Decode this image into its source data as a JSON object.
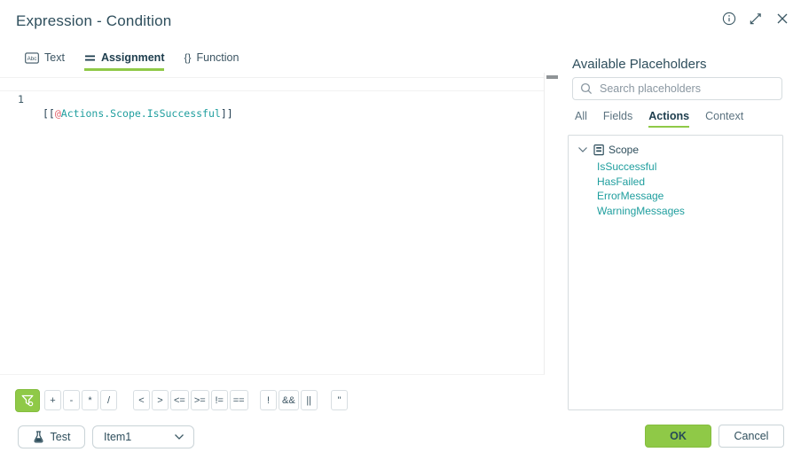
{
  "header": {
    "title": "Expression - Condition"
  },
  "editor_tabs": [
    {
      "label": "Text",
      "icon_glyph": "Abc"
    },
    {
      "label": "Assignment",
      "active": true
    },
    {
      "label": "Function",
      "icon_glyph": "{}"
    }
  ],
  "editor": {
    "line_number": "1",
    "code": {
      "open": "[[",
      "at": "@",
      "path": "Actions.Scope.IsSuccessful",
      "close": "]]"
    }
  },
  "operators": {
    "g0": [
      "+",
      "-",
      "*",
      "/"
    ],
    "g1": [
      "<",
      ">",
      "<=",
      ">=",
      "!=",
      "=="
    ],
    "g2": [
      "!",
      "&&",
      "||"
    ],
    "g3": [
      "\""
    ]
  },
  "footer": {
    "test_label": "Test",
    "item_value": "Item1",
    "ok_label": "OK",
    "cancel_label": "Cancel"
  },
  "placeholders_panel": {
    "title": "Available Placeholders",
    "search_placeholder": "Search placeholders",
    "tabs": [
      {
        "label": "All"
      },
      {
        "label": "Fields"
      },
      {
        "label": "Actions",
        "active": true
      },
      {
        "label": "Context"
      }
    ],
    "tree": {
      "root": "Scope",
      "children": [
        "IsSuccessful",
        "HasFailed",
        "ErrorMessage",
        "WarningMessages"
      ]
    }
  },
  "colors": {
    "accent_green": "#8fc947",
    "teal": "#1f9e9e",
    "dark": "#2e4e5c",
    "red": "#e4606a",
    "border": "#d6dcdf",
    "muted": "#8a97a1"
  }
}
